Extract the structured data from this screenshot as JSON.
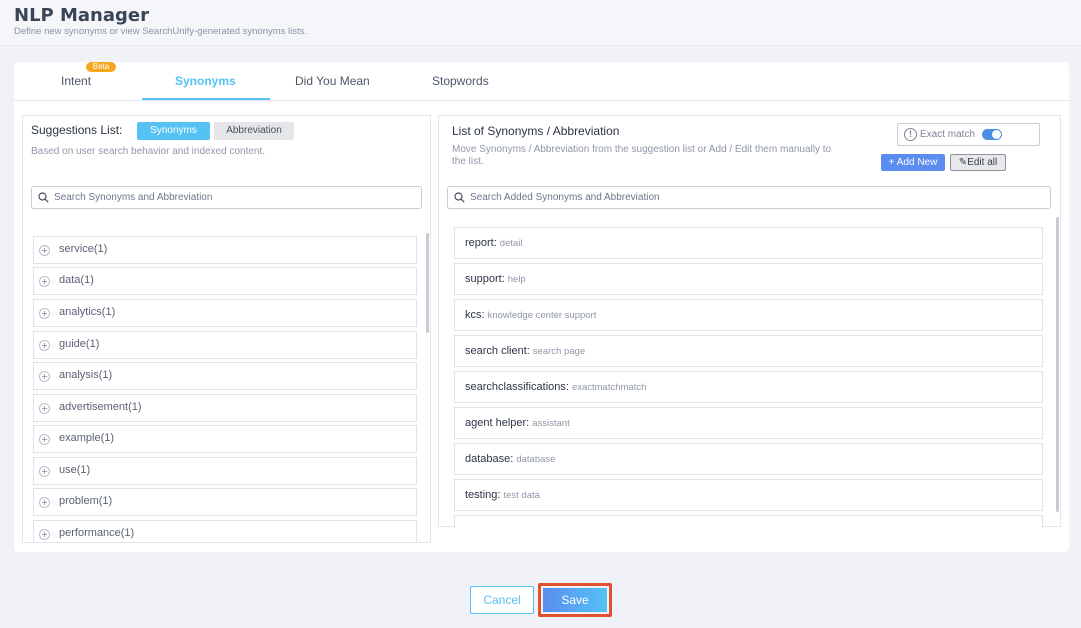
{
  "header": {
    "title": "NLP Manager",
    "subtitle": "Define new synonyms or view SearchUnify-generated synonyms lists."
  },
  "tabs": [
    {
      "label": "Intent",
      "badge": "Beta"
    },
    {
      "label": "Synonyms"
    },
    {
      "label": "Did You Mean"
    },
    {
      "label": "Stopwords"
    }
  ],
  "suggestions": {
    "title": "Suggestions List:",
    "chip_synonyms": "Synonyms",
    "chip_abbreviation": "Abbreviation",
    "description": "Based on user search behavior and indexed content.",
    "search_placeholder": "Search Synonyms and Abbreviation",
    "items": [
      "service(1)",
      "data(1)",
      "analytics(1)",
      "guide(1)",
      "analysis(1)",
      "advertisement(1)",
      "example(1)",
      "use(1)",
      "problem(1)",
      "performance(1)"
    ]
  },
  "synonyms_list": {
    "title": "List of Synonyms / Abbreviation",
    "description": "Move Synonyms / Abbreviation from the suggestion list or Add / Edit them manually to the list.",
    "exact_match_label": "Exact match",
    "exact_match_on": true,
    "add_new_label": "Add New",
    "edit_all_label": "Edit all",
    "search_placeholder": "Search Added Synonyms and Abbreviation",
    "items": [
      {
        "term": "report:",
        "value": "detail"
      },
      {
        "term": "support:",
        "value": "help"
      },
      {
        "term": "kcs:",
        "value": "knowledge center support"
      },
      {
        "term": "search client:",
        "value": "search page"
      },
      {
        "term": "searchclassifications:",
        "value": "exactmatchmatch"
      },
      {
        "term": "agent helper:",
        "value": "assistant"
      },
      {
        "term": "database:",
        "value": "database"
      },
      {
        "term": "testing:",
        "value": "test data"
      },
      {
        "term": "",
        "value": ""
      }
    ]
  },
  "footer": {
    "cancel_label": "Cancel",
    "save_label": "Save"
  },
  "colors": {
    "accent": "#55c2f3",
    "primary_blue": "#5b8cf0",
    "beta_badge": "#f4a81d",
    "highlight_border": "#e0512f"
  }
}
